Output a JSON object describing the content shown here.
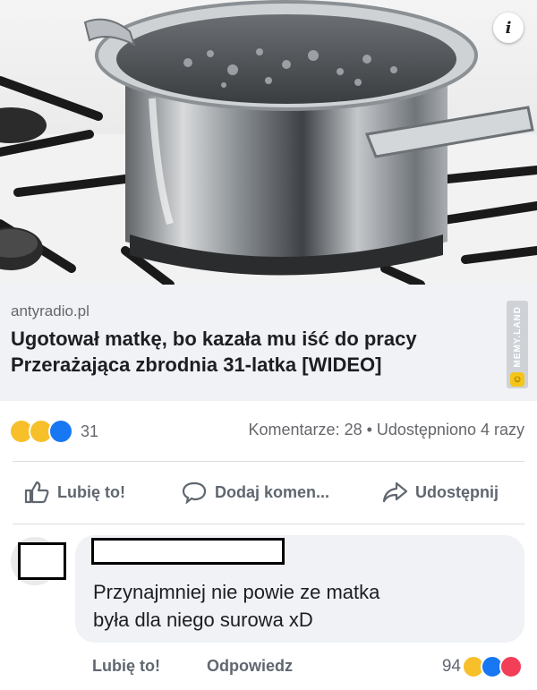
{
  "post": {
    "info_icon": "info-icon",
    "link_domain": "antyradio.pl",
    "headline": "Ugotował matkę, bo kazała mu iść do pracy\nPrzerażająca zbrodnia 31-latka [WIDEO]"
  },
  "watermark": {
    "text": "MEMY.LAND"
  },
  "stats": {
    "reactions": [
      "haha",
      "wow",
      "like"
    ],
    "reaction_count": "31",
    "comments_shares": "Komentarze: 28 • Udostępniono 4 razy"
  },
  "actions": {
    "like": "Lubię to!",
    "comment": "Dodaj komen...",
    "share": "Udostępnij"
  },
  "comment": {
    "text": "Przynajmniej nie powie ze matka\nbyła dla niego surowa xD",
    "like": "Lubię to!",
    "reply": "Odpowiedz",
    "reaction_count": "94",
    "reactions": [
      "haha",
      "like",
      "love"
    ]
  },
  "colors": {
    "link_gray": "#65676b",
    "action_gray": "#606770",
    "like_blue": "#1877f2",
    "haha_yellow": "#f7c02a",
    "love_red": "#f33e58"
  }
}
